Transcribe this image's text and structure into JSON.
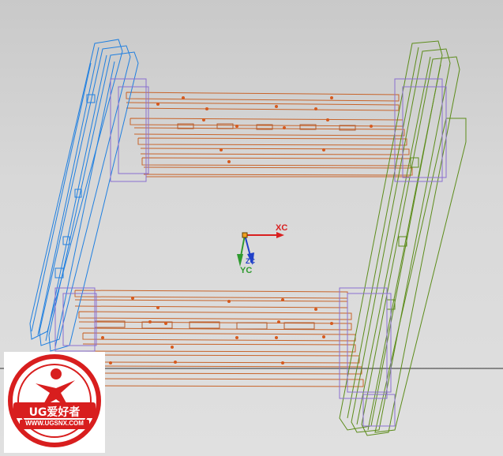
{
  "viewport": {
    "background_top": "#c9c9c9",
    "background_bottom": "#e0e0e0"
  },
  "model": {
    "colors": {
      "left_frame": "#1f7fe0",
      "right_frame": "#5c8c1a",
      "cross_members": "#c8642a",
      "fasteners": "#d65a1e",
      "brackets": "#8a6fd0"
    }
  },
  "csys": {
    "xc_label": "XC",
    "yc_label": "YC",
    "zc_label": "ZC",
    "x_color": "#d92020",
    "y_color": "#2e9a2e",
    "z_color": "#2040c8"
  },
  "watermark": {
    "brand": "UG爱好者",
    "url": "WWW.UGSNX.COM",
    "red": "#d81e1e"
  }
}
